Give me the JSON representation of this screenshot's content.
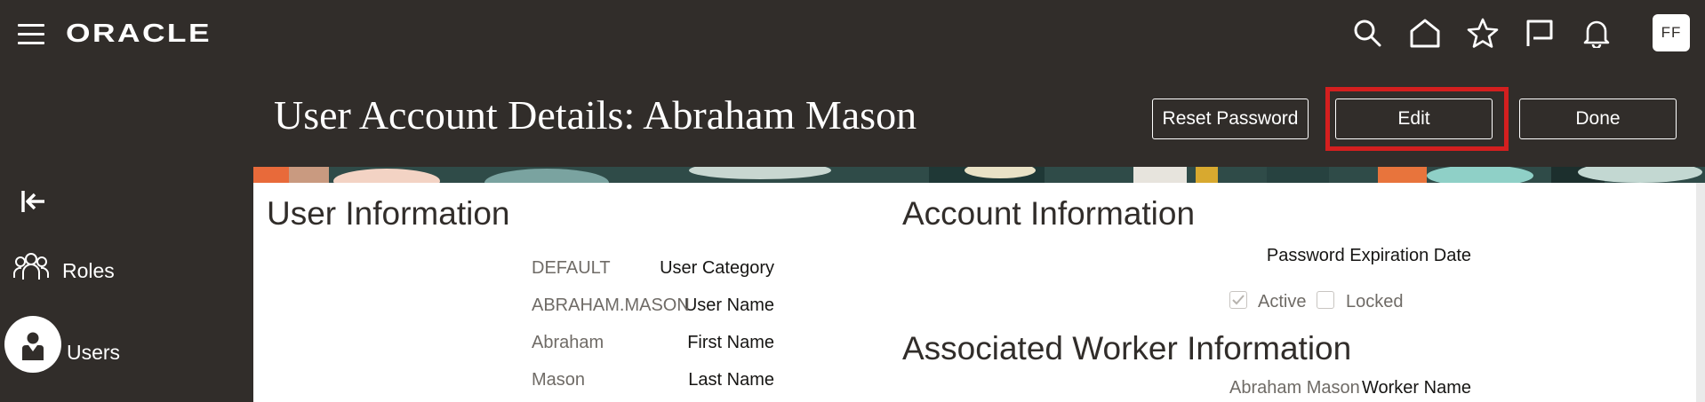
{
  "header": {
    "logo": "ORACLE",
    "avatar_initials": "FF",
    "icons": [
      "search-icon",
      "home-icon",
      "favorites-star-icon",
      "flag-icon",
      "notifications-bell-icon"
    ]
  },
  "page": {
    "title": "User Account Details: Abraham Mason",
    "buttons": {
      "reset_password": "Reset Password",
      "edit": "Edit",
      "done": "Done"
    }
  },
  "sidebar": {
    "items": [
      {
        "label": "Roles",
        "icon": "roles-group-icon"
      },
      {
        "label": "Users",
        "icon": "user-icon"
      }
    ]
  },
  "user_information": {
    "title": "User Information",
    "fields": [
      {
        "label": "User Category",
        "value": "DEFAULT"
      },
      {
        "label": "User Name",
        "value": "ABRAHAM.MASON"
      },
      {
        "label": "First Name",
        "value": "Abraham"
      },
      {
        "label": "Last Name",
        "value": "Mason"
      }
    ]
  },
  "account_information": {
    "title": "Account Information",
    "password_expiration_label": "Password Expiration Date",
    "password_expiration_value": "",
    "active_label": "Active",
    "active_checked": true,
    "locked_label": "Locked",
    "locked_checked": false
  },
  "associated_worker": {
    "title": "Associated Worker Information",
    "worker_name_label": "Worker Name",
    "worker_name_value": "Abraham Mason"
  },
  "colors": {
    "header_bg": "#312d2a",
    "highlight": "#d41f1f",
    "content_bg": "#ffffff"
  }
}
